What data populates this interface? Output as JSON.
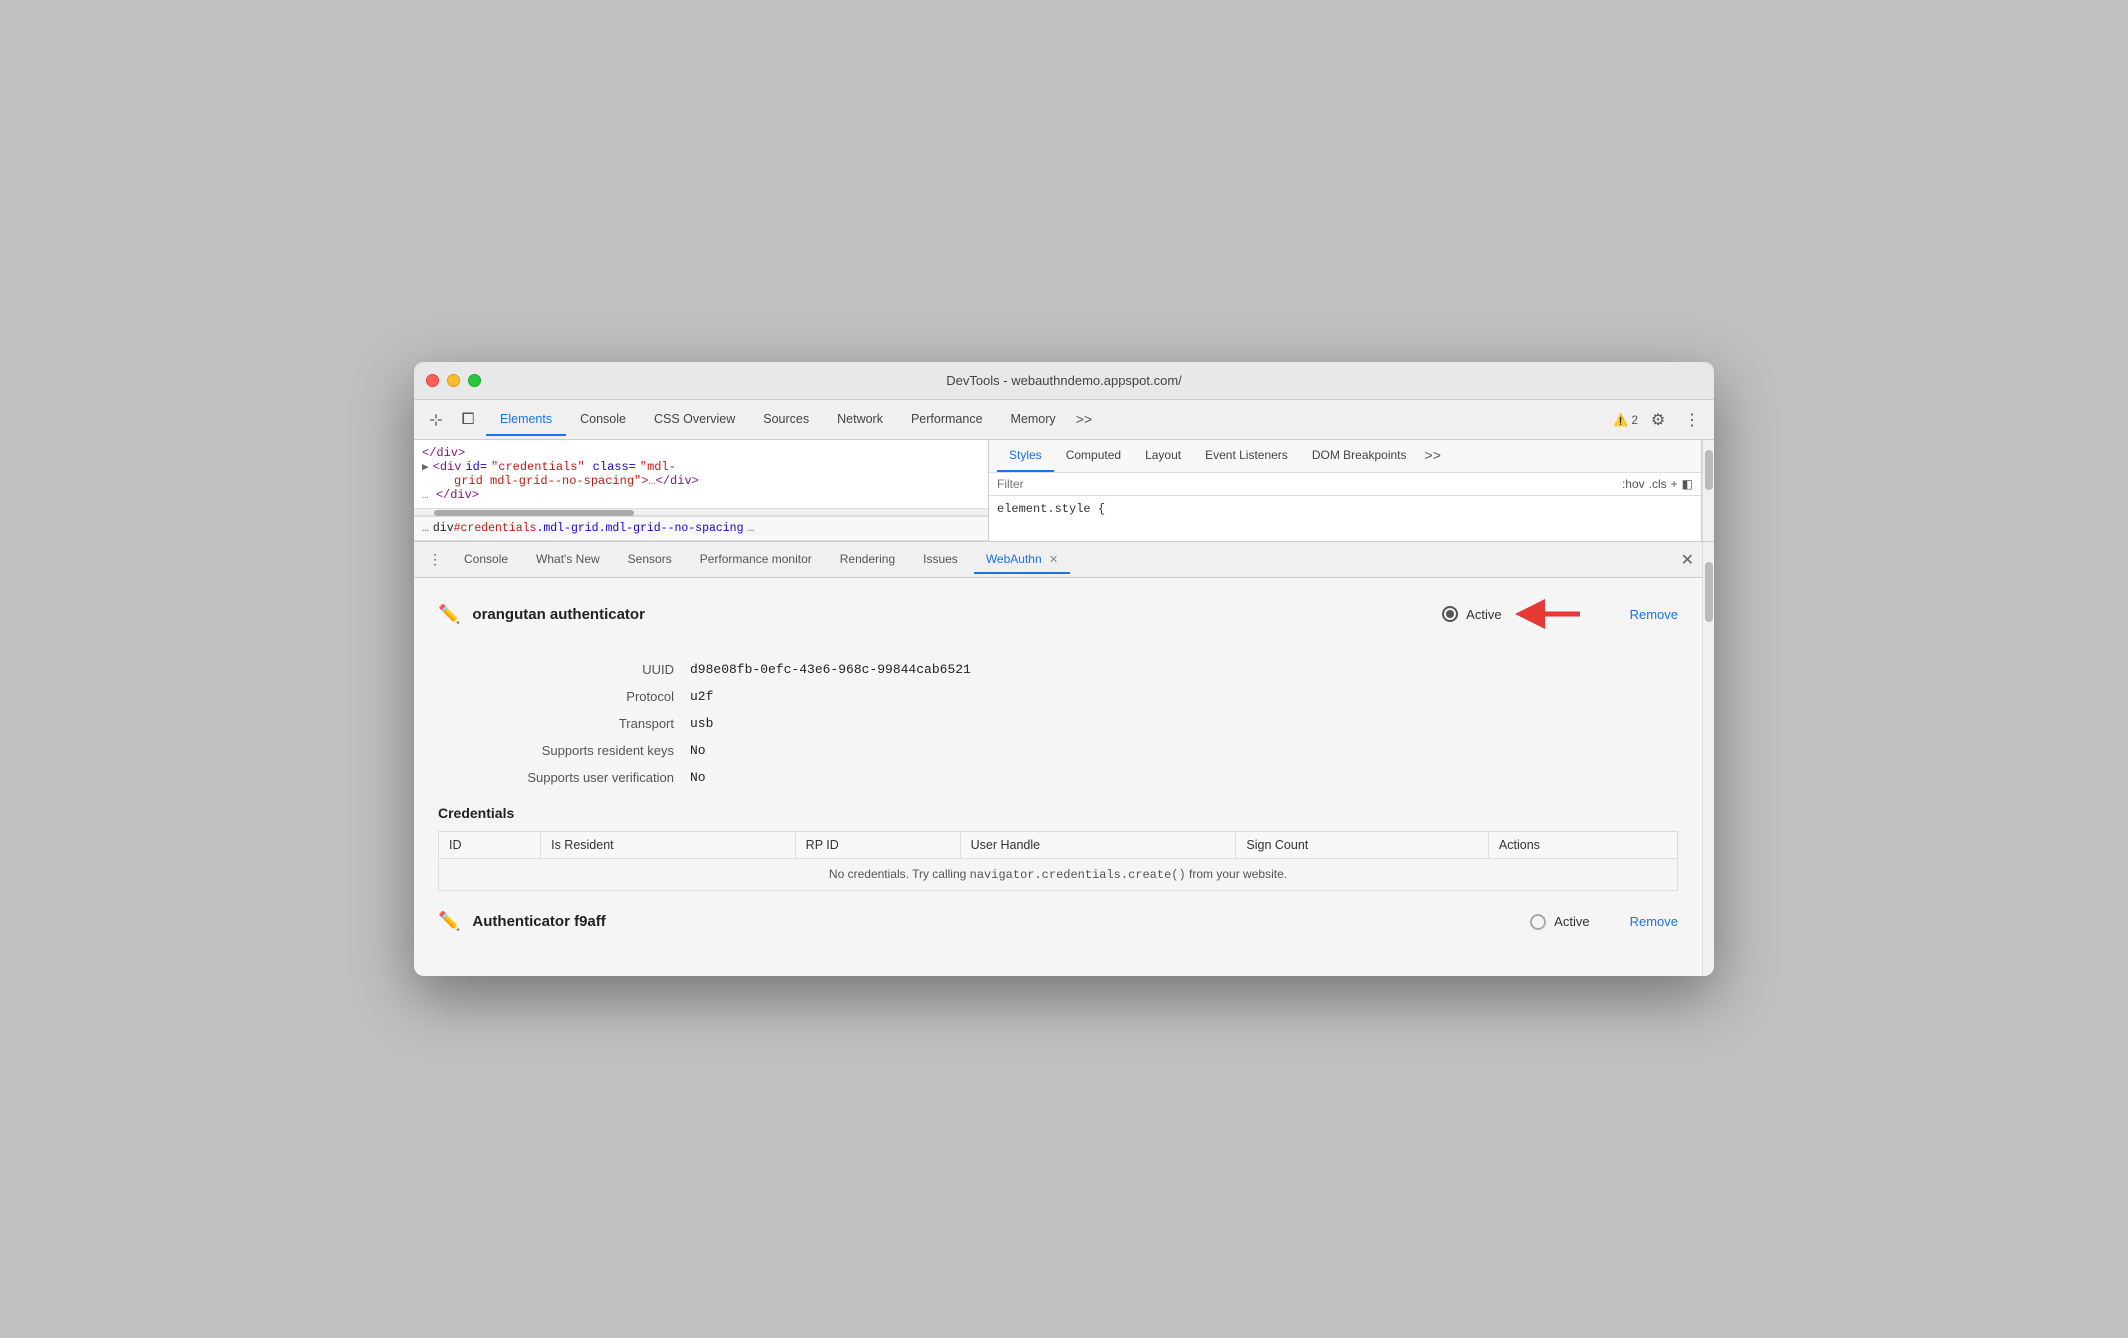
{
  "window": {
    "title": "DevTools - webauthndemo.appspot.com/"
  },
  "devtools": {
    "tabs": [
      {
        "label": "Elements",
        "active": true
      },
      {
        "label": "Console",
        "active": false
      },
      {
        "label": "CSS Overview",
        "active": false
      },
      {
        "label": "Sources",
        "active": false
      },
      {
        "label": "Network",
        "active": false
      },
      {
        "label": "Performance",
        "active": false
      },
      {
        "label": "Memory",
        "active": false
      }
    ],
    "warning_count": "2",
    "more_tabs": ">>"
  },
  "elements_panel": {
    "div_close": "</div>",
    "div_credentials": "<div id=\"credentials\" class=\"mdl-grid mdl-grid--no-spacing\">…</div>",
    "div_close2": "</div>",
    "breadcrumb": "div#credentials.mdl-grid.mdl-grid--no-spacing"
  },
  "styles_panel": {
    "tabs": [
      "Styles",
      "Computed",
      "Layout",
      "Event Listeners",
      "DOM Breakpoints"
    ],
    "active_tab": "Styles",
    "filter_placeholder": "Filter",
    "hov_label": ":hov",
    "cls_label": ".cls",
    "element_style": "element.style {"
  },
  "bottom_tabs": [
    {
      "label": "Console",
      "active": false,
      "closeable": false
    },
    {
      "label": "What's New",
      "active": false,
      "closeable": false
    },
    {
      "label": "Sensors",
      "active": false,
      "closeable": false
    },
    {
      "label": "Performance monitor",
      "active": false,
      "closeable": false
    },
    {
      "label": "Rendering",
      "active": false,
      "closeable": false
    },
    {
      "label": "Issues",
      "active": false,
      "closeable": false
    },
    {
      "label": "WebAuthn",
      "active": true,
      "closeable": true
    }
  ],
  "webauthn": {
    "authenticator1": {
      "name": "orangutan authenticator",
      "active": true,
      "active_label": "Active",
      "remove_label": "Remove",
      "uuid_label": "UUID",
      "uuid_value": "d98e08fb-0efc-43e6-968c-99844cab6521",
      "protocol_label": "Protocol",
      "protocol_value": "u2f",
      "transport_label": "Transport",
      "transport_value": "usb",
      "resident_keys_label": "Supports resident keys",
      "resident_keys_value": "No",
      "user_verification_label": "Supports user verification",
      "user_verification_value": "No"
    },
    "credentials_section": {
      "title": "Credentials",
      "columns": [
        "ID",
        "Is Resident",
        "RP ID",
        "User Handle",
        "Sign Count",
        "Actions"
      ],
      "empty_message_prefix": "No credentials. Try calling ",
      "empty_message_code": "navigator.credentials.create()",
      "empty_message_suffix": " from your website."
    },
    "authenticator2": {
      "name": "Authenticator f9aff",
      "active": false,
      "active_label": "Active",
      "remove_label": "Remove"
    }
  }
}
